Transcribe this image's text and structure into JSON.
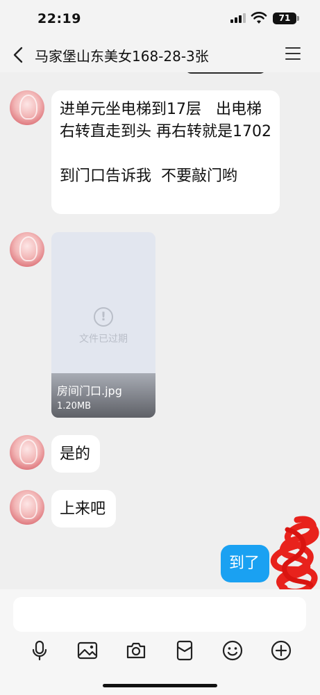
{
  "status_bar": {
    "time": "22:19",
    "battery": "71"
  },
  "header": {
    "title": "马家堡山东美女168-28-3张"
  },
  "messages": {
    "m1": "进单元坐电梯到17层   出电梯右转直走到头 再右转就是1702\n\n到门口告诉我  不要敲门哟",
    "file": {
      "status": "文件已过期",
      "name": "房间门口.jpg",
      "size": "1.20MB"
    },
    "m3": "是的",
    "m4": "上来吧",
    "sent": "到了"
  },
  "input_bar": {
    "placeholder": ""
  },
  "colors": {
    "sent_bubble": "#1aa1f2",
    "background": "#efefef",
    "scribble": "#e8221c"
  },
  "icons": [
    "back-icon",
    "menu-icon",
    "microphone-icon",
    "image-icon",
    "camera-icon",
    "red-packet-icon",
    "emoji-icon",
    "plus-icon"
  ]
}
